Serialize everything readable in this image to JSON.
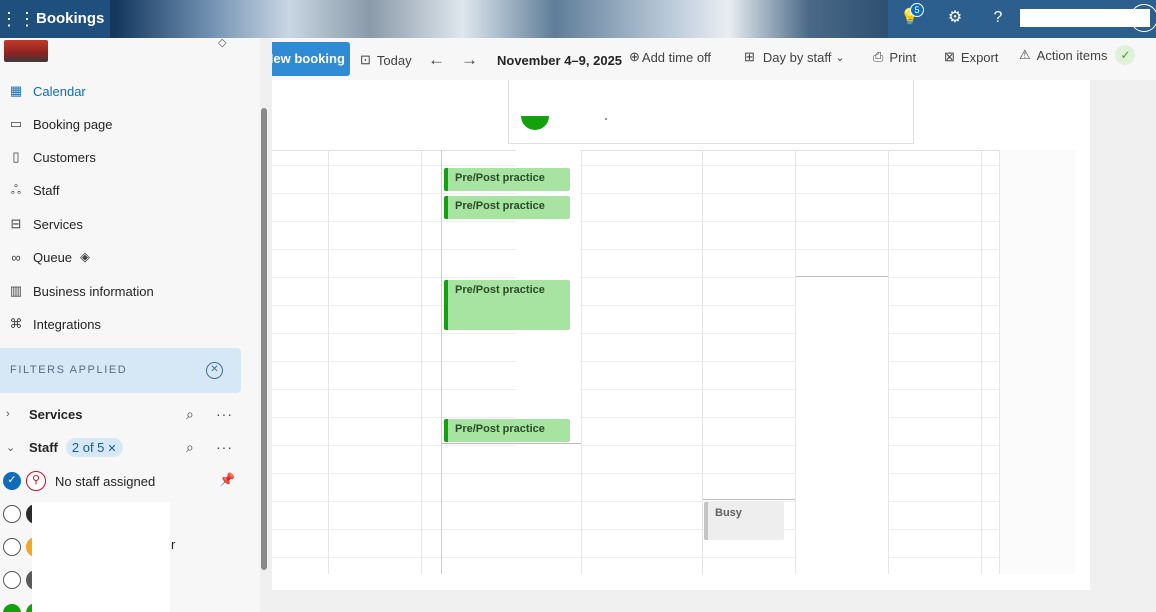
{
  "app": {
    "name": "Bookings",
    "notification_count": "5",
    "icons": [
      "waffle-icon",
      "lightbulb-icon",
      "gear-icon",
      "help-icon"
    ]
  },
  "nav": {
    "items": [
      {
        "label": "Calendar",
        "icon": "calendar-icon",
        "active": true
      },
      {
        "label": "Booking page",
        "icon": "monitor-icon"
      },
      {
        "label": "Customers",
        "icon": "clipboard-person-icon"
      },
      {
        "label": "Staff",
        "icon": "people-icon"
      },
      {
        "label": "Services",
        "icon": "briefcase-icon"
      },
      {
        "label": "Queue",
        "icon": "queue-icon",
        "badge_icon": "diamond-icon"
      },
      {
        "label": "Business information",
        "icon": "building-icon"
      },
      {
        "label": "Integrations",
        "icon": "integrations-icon"
      }
    ]
  },
  "filters": {
    "header": "FILTERS APPLIED",
    "services_label": "Services",
    "staff_label": "Staff",
    "staff_chip": "2 of 5",
    "staff_list": [
      {
        "name": "No staff assigned",
        "checked": true
      },
      {
        "name": "",
        "checked": false,
        "avatar_color": "#2b2b2b"
      },
      {
        "name": "",
        "checked": false,
        "avatar_color": "#f5a623"
      },
      {
        "name": "",
        "checked": false,
        "avatar_color": "#5a5a5a"
      },
      {
        "name": "",
        "checked": false,
        "avatar_color": "#13a10e"
      }
    ],
    "trailing_char": "r"
  },
  "toolbar": {
    "new_booking": "New booking",
    "today": "Today",
    "date_range": "November 4–9, 2025",
    "add_time_off": "Add time off",
    "view": "Day by staff",
    "print": "Print",
    "export": "Export",
    "action_items": "Action items"
  },
  "events": [
    {
      "title": "Pre/Post practice",
      "type": "booking"
    },
    {
      "title": "Pre/Post practice",
      "type": "booking"
    },
    {
      "title": "Pre/Post practice",
      "type": "booking"
    },
    {
      "title": "Pre/Post practice",
      "type": "booking"
    },
    {
      "title": "Busy",
      "type": "busy"
    }
  ],
  "colors": {
    "accent": "#0f6cbd",
    "event_fill": "#a7e3a1",
    "event_border": "#13a10e",
    "filters_bg": "#d6e8f5"
  }
}
